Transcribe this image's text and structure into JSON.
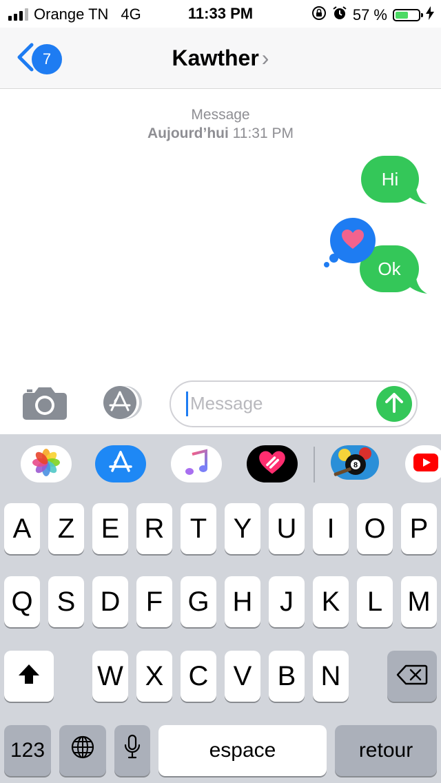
{
  "status_bar": {
    "carrier": "Orange TN",
    "network": "4G",
    "time": "11:33 PM",
    "battery_percent": "57 %",
    "battery_level": 0.57,
    "signal_bars": 3
  },
  "nav": {
    "back_badge": "7",
    "contact_name": "Kawther",
    "chevron": "›"
  },
  "conversation": {
    "header_service": "Message",
    "header_day": "Aujourd’hui",
    "header_time": "11:31 PM",
    "messages": [
      {
        "text": "Hi",
        "direction": "outgoing"
      },
      {
        "text": "Ok",
        "direction": "outgoing",
        "tapback": "heart-icon"
      }
    ]
  },
  "composer": {
    "placeholder": "Message"
  },
  "app_strip": [
    "photos-icon",
    "app-store-icon",
    "music-icon",
    "digital-touch-icon",
    "8-ball-pool-icon",
    "youtube-icon"
  ],
  "keyboard": {
    "row1": [
      "A",
      "Z",
      "E",
      "R",
      "T",
      "Y",
      "U",
      "I",
      "O",
      "P"
    ],
    "row2": [
      "Q",
      "S",
      "D",
      "F",
      "G",
      "H",
      "J",
      "K",
      "L",
      "M"
    ],
    "row3": [
      "W",
      "X",
      "C",
      "V",
      "B",
      "N"
    ],
    "numbers_label": "123",
    "space_label": "espace",
    "return_label": "retour"
  },
  "colors": {
    "bubble_green": "#34c759",
    "accent_blue": "#1e7cf2",
    "keyboard_bg": "#d2d5db",
    "function_key": "#abb0ba"
  }
}
